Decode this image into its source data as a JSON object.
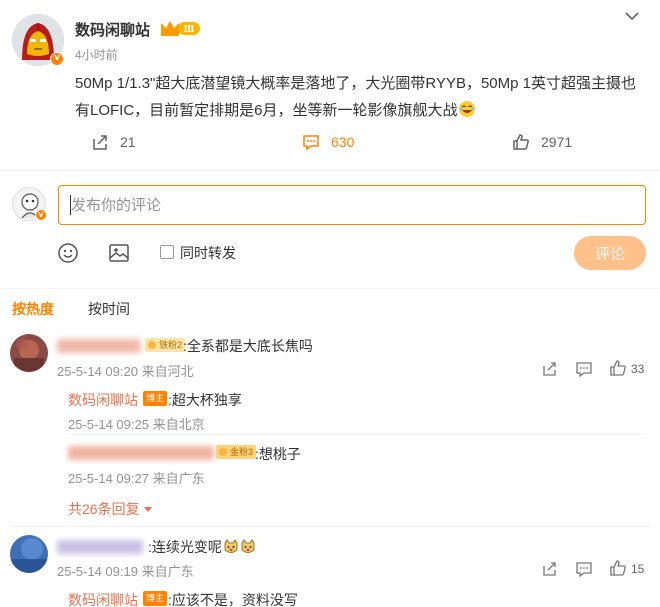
{
  "post": {
    "author": "数码闲聊站",
    "vip_level": "Ⅲ",
    "time": "4小时前",
    "text": "50Mp 1/1.3\"超大底潜望镜大概率是落地了，大光圈带RYYB，50Mp 1英寸超强主摄也有LOFIC，目前暂定排期是6月，坐等新一轮影像旗舰大战",
    "repost_count": "21",
    "comment_count": "630",
    "like_count": "2971"
  },
  "composer": {
    "placeholder": "发布你的评论",
    "repost_label": "同时转发",
    "submit_label": "评论"
  },
  "sort_tabs": {
    "hot": "按热度",
    "time": "按时间"
  },
  "comments": [
    {
      "text": ":全系都是大底长焦吗",
      "fan_badge": "铁粉2",
      "meta": "25-5-14 09:20 来自河北",
      "like_count": "33",
      "replies": [
        {
          "author": "数码闲聊站",
          "tag": "博主",
          "text": ":超大杯独享",
          "meta": "25-5-14 09:25 来自北京"
        },
        {
          "fan_badge": "金粉3",
          "text": ":想桃子",
          "meta": "25-5-14 09:27 来自广东"
        }
      ],
      "more_replies": "共26条回复"
    },
    {
      "text": ":连续光变呢",
      "meta": "25-5-14 09:19 来自广东",
      "like_count": "15",
      "replies": [
        {
          "author": "数码闲聊站",
          "tag": "博主",
          "text": ":应该不是，资料没写"
        }
      ]
    }
  ],
  "colors": {
    "accent": "#ff8200",
    "reply_name": "#eb7350",
    "meta_gray": "#939393"
  }
}
